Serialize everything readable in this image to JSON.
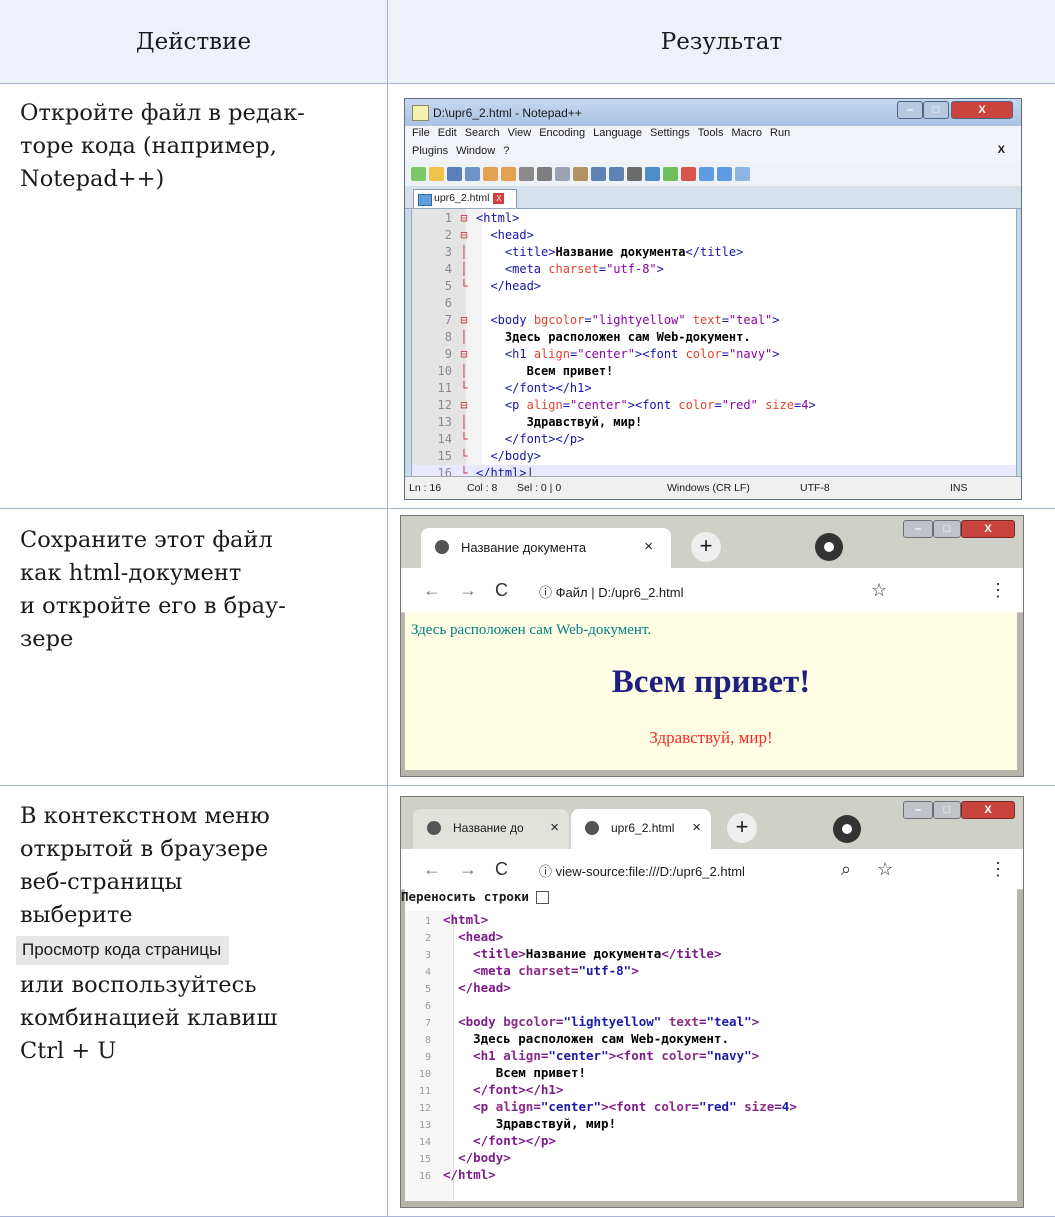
{
  "table": {
    "header_action": "Действие",
    "header_result": "Результат"
  },
  "rows": [
    {
      "action_lines": [
        "Откройте файл в редак-",
        "торе кода (например,",
        "Notepad++)"
      ]
    },
    {
      "action_lines": [
        "Сохраните этот файл",
        "как html-документ",
        "и откройте его в брау-",
        "зере"
      ]
    },
    {
      "action_lines_before": [
        "В контекстном меню",
        "открытой в браузере",
        "веб-страницы",
        "выберите"
      ],
      "menu_item": "Просмотр кода страницы",
      "action_lines_after": [
        "или воспользуйтесь",
        "комбинацией клавиш",
        "Ctrl + U"
      ]
    }
  ],
  "notepad": {
    "title": "D:\\upr6_2.html - Notepad++",
    "menu_row1": [
      "File",
      "Edit",
      "Search",
      "View",
      "Encoding",
      "Language",
      "Settings",
      "Tools",
      "Macro",
      "Run"
    ],
    "menu_row2": [
      "Plugins",
      "Window",
      "?"
    ],
    "menu_close": "X",
    "tab_label": "upr6_2.html",
    "status": {
      "ln": "Ln : 16",
      "col": "Col : 8",
      "sel": "Sel : 0 | 0",
      "eol": "Windows (CR LF)",
      "enc": "UTF-8",
      "mode": "INS"
    },
    "line_numbers": [
      "1",
      "2",
      "3",
      "4",
      "5",
      "6",
      "7",
      "8",
      "9",
      "10",
      "11",
      "12",
      "13",
      "14",
      "15",
      "16"
    ]
  },
  "browser1": {
    "tab_title": "Название документа",
    "tab_close": "×",
    "new_tab": "+",
    "address_prefix": "Файл",
    "address_url": "D:/upr6_2.html",
    "page_line": "Здесь расположен сам Web-документ.",
    "page_heading": "Всем привет!",
    "page_paragraph": "Здравствуй, мир!",
    "colors": {
      "teal": "#008080",
      "navy": "#1f1f80",
      "red": "#ff2a2a",
      "background": "#fffde3"
    }
  },
  "browser2": {
    "tab1_title": "Название до",
    "tab2_title": "upr6_2.html",
    "tab_close": "×",
    "new_tab": "+",
    "address_url": "view-source:file:///D:/upr6_2.html",
    "wrap_label": "Переносить строки",
    "line_numbers": [
      "1",
      "2",
      "3",
      "4",
      "5",
      "6",
      "7",
      "8",
      "9",
      "10",
      "11",
      "12",
      "13",
      "14",
      "15",
      "16"
    ]
  },
  "code": {
    "html_open": "<html>",
    "head_open": "<head>",
    "title_open": "<title>",
    "title_text": "Название документа",
    "title_close": "</title>",
    "meta_tag": "<meta",
    "charset_attr": "charset",
    "charset_val": "\"utf-8\"",
    "tag_close": ">",
    "head_close": "</head>",
    "body_tag": "<body",
    "bgcolor_attr": "bgcolor",
    "bgcolor_val": "\"lightyellow\"",
    "text_attr": "text",
    "text_val": "\"teal\"",
    "body_text": "Здесь расположен сам Web-документ.",
    "h1_tag": "<h1",
    "align_attr": "align",
    "center_val": "\"center\"",
    "font_tag": "<font",
    "color_attr": "color",
    "navy_val": "\"navy\"",
    "h1_text": "Всем привет!",
    "font_h1_close": "</font></h1>",
    "p_tag": "<p",
    "red_val": "\"red\"",
    "size_attr": "size",
    "size_val": "4",
    "p_text": "Здравствуй, мир!",
    "font_p_close": "</font></p>",
    "body_close": "</body>",
    "html_close": "</html>"
  }
}
